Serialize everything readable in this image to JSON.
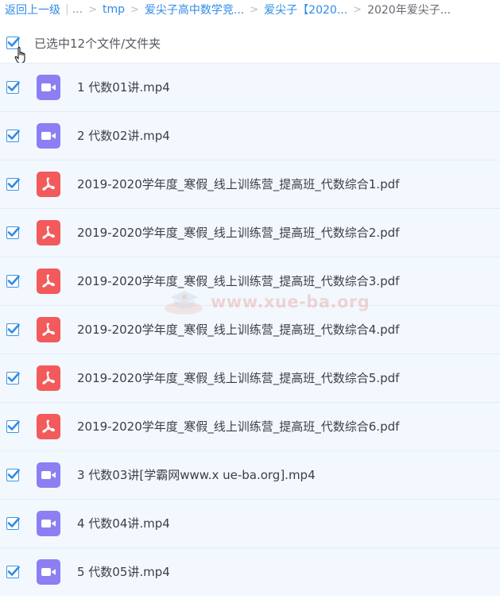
{
  "breadcrumb": {
    "back": "返回上一级",
    "ellipsis": "...",
    "items": [
      "tmp",
      "爱尖子高中数学竞...",
      "爱尖子【2020...",
      "2020年爱尖子..."
    ]
  },
  "select_all": {
    "label": "已选中12个文件/文件夹",
    "checked": true
  },
  "files": [
    {
      "name": "1 代数01讲.mp4",
      "type": "video",
      "checked": true
    },
    {
      "name": "2 代数02讲.mp4",
      "type": "video",
      "checked": true
    },
    {
      "name": "2019-2020学年度_寒假_线上训练营_提高班_代数综合1.pdf",
      "type": "pdf",
      "checked": true
    },
    {
      "name": "2019-2020学年度_寒假_线上训练营_提高班_代数综合2.pdf",
      "type": "pdf",
      "checked": true
    },
    {
      "name": "2019-2020学年度_寒假_线上训练营_提高班_代数综合3.pdf",
      "type": "pdf",
      "checked": true
    },
    {
      "name": "2019-2020学年度_寒假_线上训练营_提高班_代数综合4.pdf",
      "type": "pdf",
      "checked": true
    },
    {
      "name": "2019-2020学年度_寒假_线上训练营_提高班_代数综合5.pdf",
      "type": "pdf",
      "checked": true
    },
    {
      "name": "2019-2020学年度_寒假_线上训练营_提高班_代数综合6.pdf",
      "type": "pdf",
      "checked": true
    },
    {
      "name": "3 代数03讲[学霸网www.x ue-ba.org].mp4",
      "type": "video",
      "checked": true
    },
    {
      "name": "4 代数04讲.mp4",
      "type": "video",
      "checked": true
    },
    {
      "name": "5 代数05讲.mp4",
      "type": "video",
      "checked": true
    }
  ],
  "watermark": "www.xue-ba.org",
  "icons": {
    "checkbox": "checkbox-checked-icon",
    "video": "video-file-icon",
    "pdf": "pdf-file-icon",
    "cursor": "hand-cursor-icon"
  },
  "colors": {
    "accent": "#2f8be6",
    "row_bg": "#f2f8fe",
    "video_icon": "#8e7ef3",
    "pdf_icon": "#f25a5c"
  }
}
